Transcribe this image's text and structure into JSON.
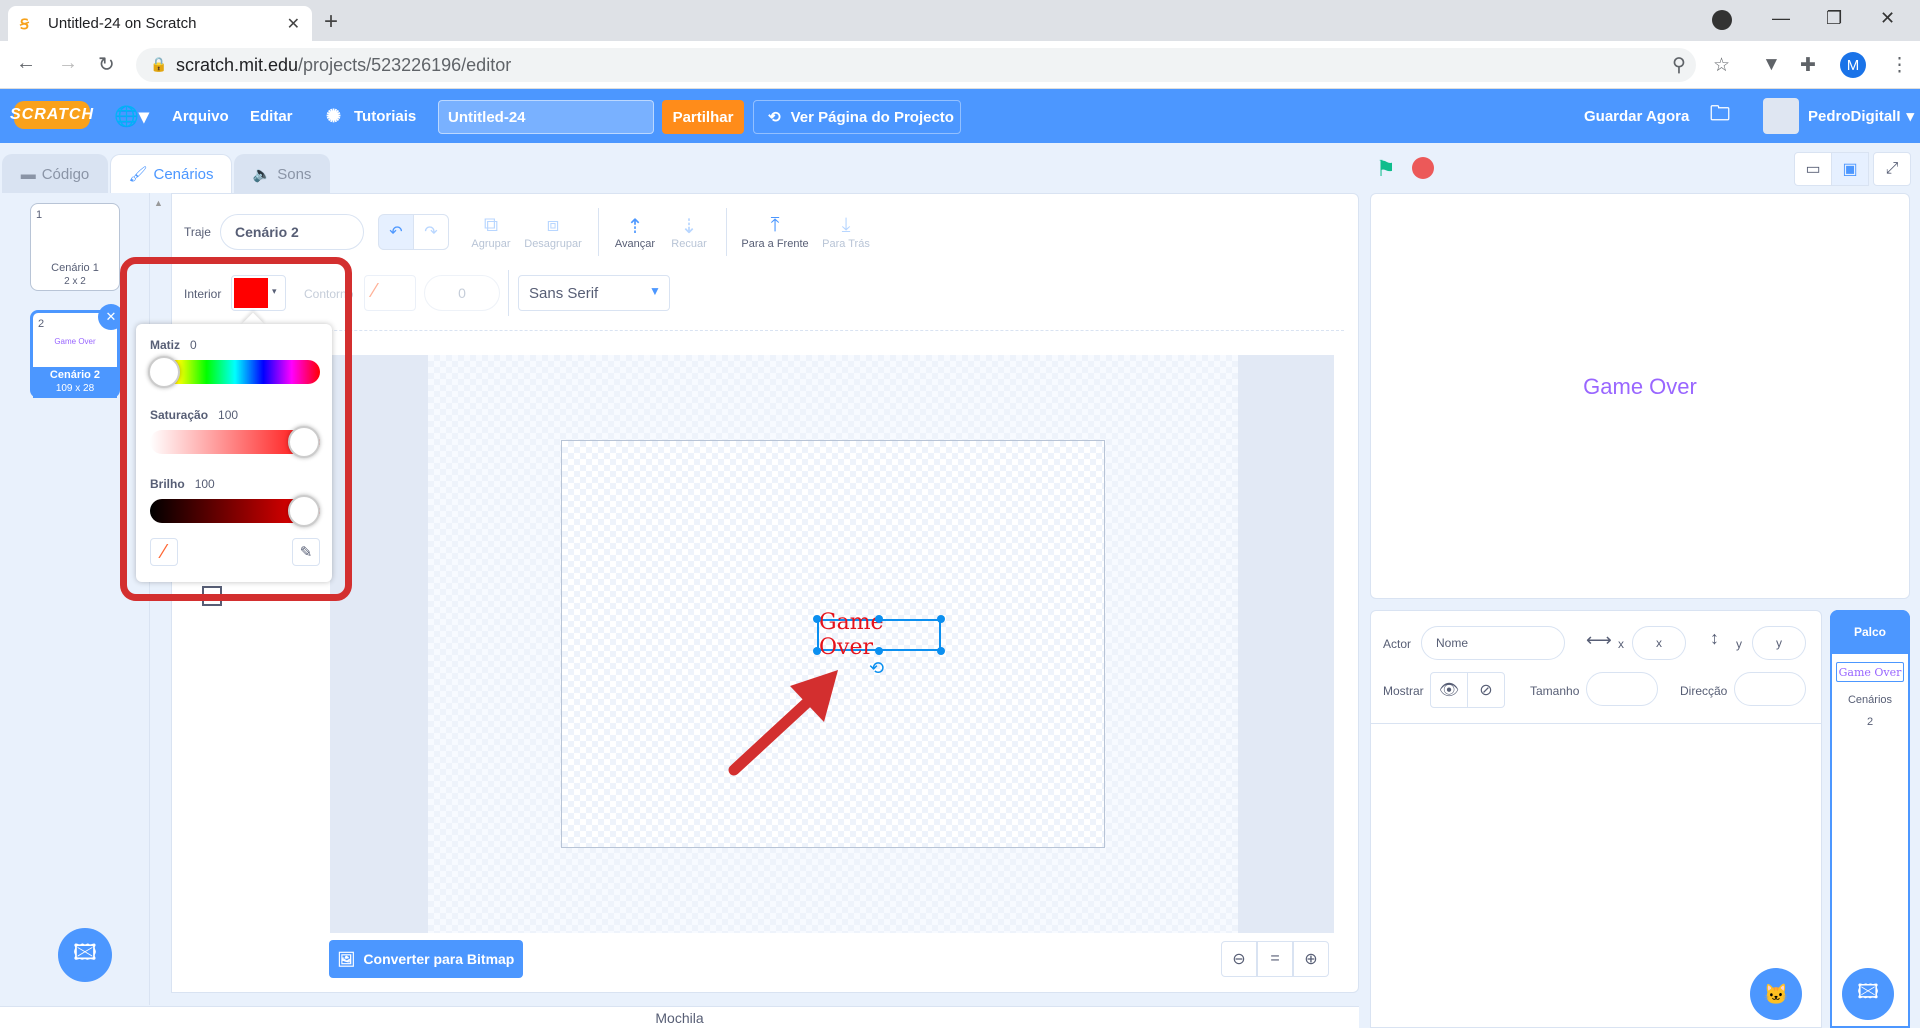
{
  "browser": {
    "tab_title": "Untitled-24 on Scratch",
    "url_host": "scratch.mit.edu",
    "url_path": "/projects/523226196/editor",
    "profile_initial": "M"
  },
  "menubar": {
    "logo": "SCRATCH",
    "file": "Arquivo",
    "edit": "Editar",
    "tutorials": "Tutoriais",
    "project_title": "Untitled-24",
    "share": "Partilhar",
    "project_page": "Ver Página do Projecto",
    "save_now": "Guardar Agora",
    "username": "PedroDigitalI"
  },
  "editor_tabs": {
    "code": "Código",
    "costumes": "Cenários",
    "sounds": "Sons"
  },
  "costumes": [
    {
      "number": "1",
      "name": "Cenário 1",
      "size": "2 x 2"
    },
    {
      "number": "2",
      "name": "Cenário 2",
      "size": "109 x 28",
      "thumb_text": "Game Over"
    }
  ],
  "paint": {
    "costume_label": "Traje",
    "costume_name": "Cenário 2",
    "group": "Agrupar",
    "ungroup": "Desagrupar",
    "forward": "Avançar",
    "backward": "Recuar",
    "front": "Para a Frente",
    "back": "Para Trás",
    "fill_label": "Interior",
    "outline_label": "Contorno",
    "outline_width": "0",
    "font": "Sans Serif",
    "canvas_text": "Game Over",
    "convert_bitmap": "Converter para Bitmap",
    "fill_color": "#ff0000"
  },
  "color_picker": {
    "hue_label": "Matiz",
    "hue_value": "0",
    "saturation_label": "Saturação",
    "saturation_value": "100",
    "brightness_label": "Brilho",
    "brightness_value": "100"
  },
  "stage": {
    "text": "Game Over"
  },
  "sprite_info": {
    "sprite_label": "Actor",
    "name_placeholder": "Nome",
    "x_label": "x",
    "x_placeholder": "x",
    "y_label": "y",
    "y_placeholder": "y",
    "show_label": "Mostrar",
    "size_label": "Tamanho",
    "direction_label": "Direcção"
  },
  "stage_panel": {
    "label": "Palco",
    "thumb_text": "Game Over",
    "backdrops_label": "Cenários",
    "backdrops_count": "2"
  },
  "backpack": "Mochila",
  "colors": {
    "scratch_blue": "#4c97ff",
    "share_orange": "#ff8c1a",
    "annotation_red": "#d32f2f",
    "text_purple": "#9966ff"
  }
}
